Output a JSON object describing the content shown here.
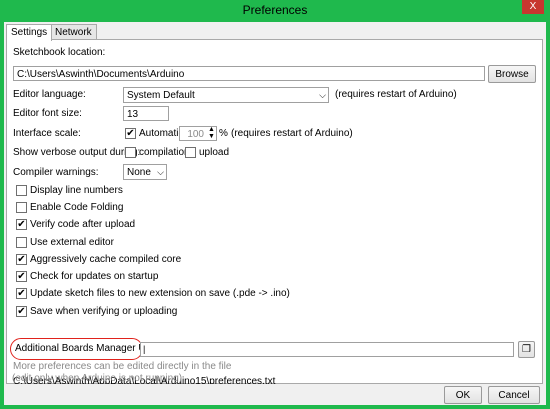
{
  "window": {
    "title": "Preferences",
    "close_glyph": "X"
  },
  "tabs": [
    {
      "label": "Settings"
    },
    {
      "label": "Network"
    }
  ],
  "sketchbook": {
    "label": "Sketchbook location:",
    "value": "C:\\Users\\Aswinth\\Documents\\Arduino",
    "browse_label": "Browse"
  },
  "language": {
    "label": "Editor language:",
    "value": "System Default",
    "note": "(requires restart of Arduino)"
  },
  "font_size": {
    "label": "Editor font size:",
    "value": "13"
  },
  "scale": {
    "label": "Interface scale:",
    "automatic_label": "Automatic",
    "automatic_checked": true,
    "value": "100",
    "unit": "%",
    "note": "(requires restart of Arduino)"
  },
  "verbose": {
    "label": "Show verbose output during:",
    "compilation_label": "compilation",
    "upload_label": "upload"
  },
  "warnings": {
    "label": "Compiler warnings:",
    "value": "None"
  },
  "options": [
    {
      "label": "Display line numbers",
      "checked": false
    },
    {
      "label": "Enable Code Folding",
      "checked": false
    },
    {
      "label": "Verify code after upload",
      "checked": true
    },
    {
      "label": "Use external editor",
      "checked": false
    },
    {
      "label": "Aggressively cache compiled core",
      "checked": true
    },
    {
      "label": "Check for updates on startup",
      "checked": true
    },
    {
      "label": "Update sketch files to new extension on save (.pde -> .ino)",
      "checked": true
    },
    {
      "label": "Save when verifying or uploading",
      "checked": true
    }
  ],
  "boards": {
    "label": "Additional Boards Manager URLs:",
    "value": ""
  },
  "more_prefs": "More preferences can be edited directly in the file",
  "prefs_path": "C:\\Users\\Aswinth\\AppData\\Local\\Arduino15\\preferences.txt",
  "edit_note": "(edit only when Arduino is not running)",
  "footer": {
    "ok_label": "OK",
    "cancel_label": "Cancel"
  },
  "check_glyph": "✔",
  "icons": {
    "window_icon": "window-expand-icon"
  }
}
